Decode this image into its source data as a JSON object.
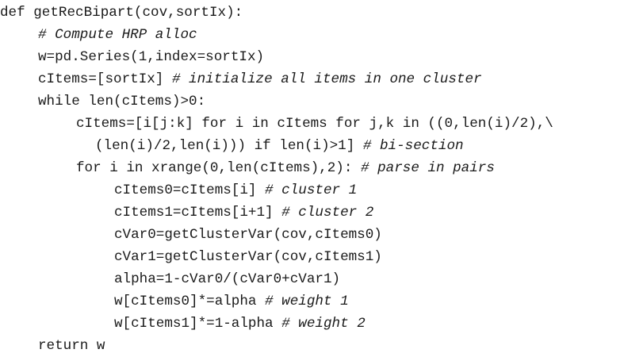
{
  "code_listing": {
    "lines": [
      {
        "indent": 0,
        "code": "def getRecBipart(cov,sortIx):",
        "comment": ""
      },
      {
        "indent": 4,
        "code": "",
        "comment": "# Compute HRP alloc"
      },
      {
        "indent": 4,
        "code": "w=pd.Series(1,index=sortIx)",
        "comment": ""
      },
      {
        "indent": 4,
        "code": "cItems=[sortIx] ",
        "comment": "# initialize all items in one cluster"
      },
      {
        "indent": 4,
        "code": "while len(cItems)>0:",
        "comment": ""
      },
      {
        "indent": 8,
        "code": "cItems=[i[j:k] for i in cItems for j,k in ((0,len(i)/2),\\",
        "comment": ""
      },
      {
        "indent": 10,
        "code": "(len(i)/2,len(i))) if len(i)>1] ",
        "comment": "# bi-section"
      },
      {
        "indent": 8,
        "code": "for i in xrange(0,len(cItems),2): ",
        "comment": "# parse in pairs"
      },
      {
        "indent": 12,
        "code": "cItems0=cItems[i] ",
        "comment": "# cluster 1"
      },
      {
        "indent": 12,
        "code": "cItems1=cItems[i+1] ",
        "comment": "# cluster 2"
      },
      {
        "indent": 12,
        "code": "cVar0=getClusterVar(cov,cItems0)",
        "comment": ""
      },
      {
        "indent": 12,
        "code": "cVar1=getClusterVar(cov,cItems1)",
        "comment": ""
      },
      {
        "indent": 12,
        "code": "alpha=1-cVar0/(cVar0+cVar1)",
        "comment": ""
      },
      {
        "indent": 12,
        "code": "w[cItems0]*=alpha ",
        "comment": "# weight 1"
      },
      {
        "indent": 12,
        "code": "w[cItems1]*=1-alpha ",
        "comment": "# weight 2"
      },
      {
        "indent": 4,
        "code": "return w",
        "comment": ""
      }
    ]
  }
}
